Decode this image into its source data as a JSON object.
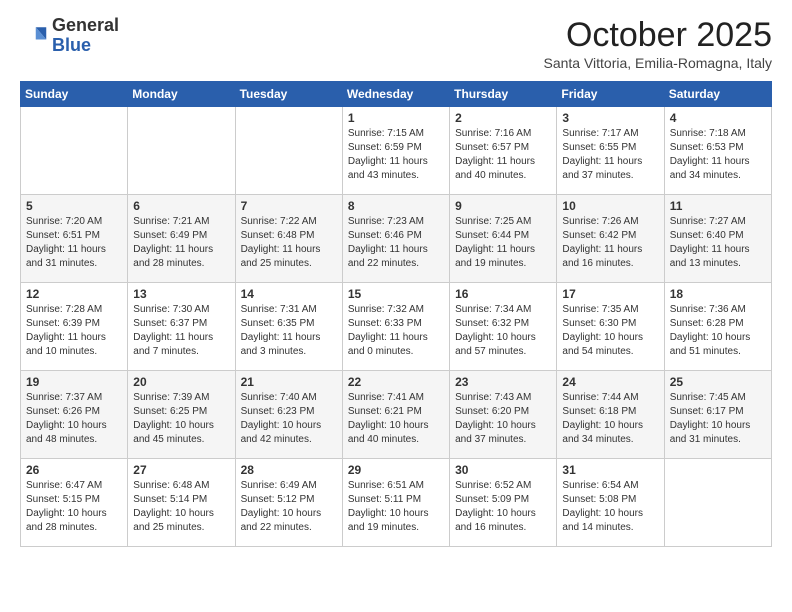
{
  "header": {
    "logo_general": "General",
    "logo_blue": "Blue",
    "month_title": "October 2025",
    "location": "Santa Vittoria, Emilia-Romagna, Italy"
  },
  "days_of_week": [
    "Sunday",
    "Monday",
    "Tuesday",
    "Wednesday",
    "Thursday",
    "Friday",
    "Saturday"
  ],
  "weeks": [
    [
      {
        "day": "",
        "content": ""
      },
      {
        "day": "",
        "content": ""
      },
      {
        "day": "",
        "content": ""
      },
      {
        "day": "1",
        "content": "Sunrise: 7:15 AM\nSunset: 6:59 PM\nDaylight: 11 hours\nand 43 minutes."
      },
      {
        "day": "2",
        "content": "Sunrise: 7:16 AM\nSunset: 6:57 PM\nDaylight: 11 hours\nand 40 minutes."
      },
      {
        "day": "3",
        "content": "Sunrise: 7:17 AM\nSunset: 6:55 PM\nDaylight: 11 hours\nand 37 minutes."
      },
      {
        "day": "4",
        "content": "Sunrise: 7:18 AM\nSunset: 6:53 PM\nDaylight: 11 hours\nand 34 minutes."
      }
    ],
    [
      {
        "day": "5",
        "content": "Sunrise: 7:20 AM\nSunset: 6:51 PM\nDaylight: 11 hours\nand 31 minutes."
      },
      {
        "day": "6",
        "content": "Sunrise: 7:21 AM\nSunset: 6:49 PM\nDaylight: 11 hours\nand 28 minutes."
      },
      {
        "day": "7",
        "content": "Sunrise: 7:22 AM\nSunset: 6:48 PM\nDaylight: 11 hours\nand 25 minutes."
      },
      {
        "day": "8",
        "content": "Sunrise: 7:23 AM\nSunset: 6:46 PM\nDaylight: 11 hours\nand 22 minutes."
      },
      {
        "day": "9",
        "content": "Sunrise: 7:25 AM\nSunset: 6:44 PM\nDaylight: 11 hours\nand 19 minutes."
      },
      {
        "day": "10",
        "content": "Sunrise: 7:26 AM\nSunset: 6:42 PM\nDaylight: 11 hours\nand 16 minutes."
      },
      {
        "day": "11",
        "content": "Sunrise: 7:27 AM\nSunset: 6:40 PM\nDaylight: 11 hours\nand 13 minutes."
      }
    ],
    [
      {
        "day": "12",
        "content": "Sunrise: 7:28 AM\nSunset: 6:39 PM\nDaylight: 11 hours\nand 10 minutes."
      },
      {
        "day": "13",
        "content": "Sunrise: 7:30 AM\nSunset: 6:37 PM\nDaylight: 11 hours\nand 7 minutes."
      },
      {
        "day": "14",
        "content": "Sunrise: 7:31 AM\nSunset: 6:35 PM\nDaylight: 11 hours\nand 3 minutes."
      },
      {
        "day": "15",
        "content": "Sunrise: 7:32 AM\nSunset: 6:33 PM\nDaylight: 11 hours\nand 0 minutes."
      },
      {
        "day": "16",
        "content": "Sunrise: 7:34 AM\nSunset: 6:32 PM\nDaylight: 10 hours\nand 57 minutes."
      },
      {
        "day": "17",
        "content": "Sunrise: 7:35 AM\nSunset: 6:30 PM\nDaylight: 10 hours\nand 54 minutes."
      },
      {
        "day": "18",
        "content": "Sunrise: 7:36 AM\nSunset: 6:28 PM\nDaylight: 10 hours\nand 51 minutes."
      }
    ],
    [
      {
        "day": "19",
        "content": "Sunrise: 7:37 AM\nSunset: 6:26 PM\nDaylight: 10 hours\nand 48 minutes."
      },
      {
        "day": "20",
        "content": "Sunrise: 7:39 AM\nSunset: 6:25 PM\nDaylight: 10 hours\nand 45 minutes."
      },
      {
        "day": "21",
        "content": "Sunrise: 7:40 AM\nSunset: 6:23 PM\nDaylight: 10 hours\nand 42 minutes."
      },
      {
        "day": "22",
        "content": "Sunrise: 7:41 AM\nSunset: 6:21 PM\nDaylight: 10 hours\nand 40 minutes."
      },
      {
        "day": "23",
        "content": "Sunrise: 7:43 AM\nSunset: 6:20 PM\nDaylight: 10 hours\nand 37 minutes."
      },
      {
        "day": "24",
        "content": "Sunrise: 7:44 AM\nSunset: 6:18 PM\nDaylight: 10 hours\nand 34 minutes."
      },
      {
        "day": "25",
        "content": "Sunrise: 7:45 AM\nSunset: 6:17 PM\nDaylight: 10 hours\nand 31 minutes."
      }
    ],
    [
      {
        "day": "26",
        "content": "Sunrise: 6:47 AM\nSunset: 5:15 PM\nDaylight: 10 hours\nand 28 minutes."
      },
      {
        "day": "27",
        "content": "Sunrise: 6:48 AM\nSunset: 5:14 PM\nDaylight: 10 hours\nand 25 minutes."
      },
      {
        "day": "28",
        "content": "Sunrise: 6:49 AM\nSunset: 5:12 PM\nDaylight: 10 hours\nand 22 minutes."
      },
      {
        "day": "29",
        "content": "Sunrise: 6:51 AM\nSunset: 5:11 PM\nDaylight: 10 hours\nand 19 minutes."
      },
      {
        "day": "30",
        "content": "Sunrise: 6:52 AM\nSunset: 5:09 PM\nDaylight: 10 hours\nand 16 minutes."
      },
      {
        "day": "31",
        "content": "Sunrise: 6:54 AM\nSunset: 5:08 PM\nDaylight: 10 hours\nand 14 minutes."
      },
      {
        "day": "",
        "content": ""
      }
    ]
  ]
}
